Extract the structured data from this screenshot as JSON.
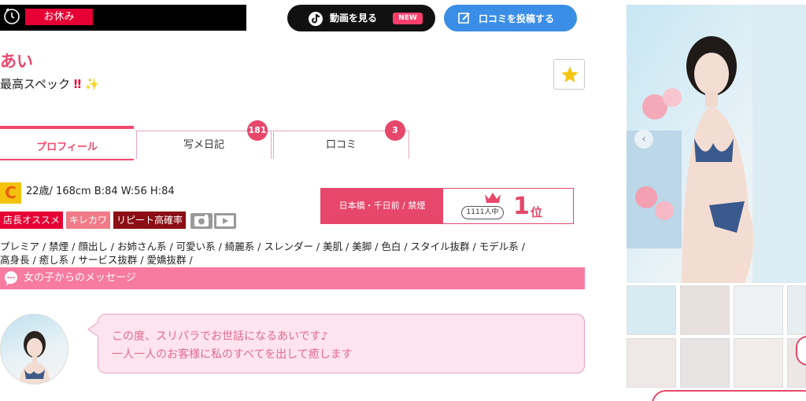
{
  "status": {
    "label": "お休み"
  },
  "buttons": {
    "video_label": "動画を見る",
    "video_badge": "NEW",
    "review_label": "口コミを投稿する"
  },
  "profile": {
    "name": "あい",
    "catchphrase": "最高スペック",
    "catch_bang": "‼",
    "catch_spark": "✨",
    "class_letter": "C",
    "stats": "22歳/ 168cm B:84 W:56 H:84",
    "tags": [
      "店長オススメ",
      "キレカワ",
      "リピート高確率"
    ],
    "types_line1": "プレミア / 禁煙 / 顔出し / お姉さん系 / 可愛い系 / 綺麗系 / スレンダー / 美肌 / 美脚 / 色白 / スタイル抜群 / モデル系 /",
    "types_line2": "高身長 / 癒し系 / サービス抜群 / 愛嬌抜群 /"
  },
  "tabs": [
    {
      "label": "プロフィール"
    },
    {
      "label": "写メ日記",
      "badge": "181"
    },
    {
      "label": "口コミ",
      "badge": "3"
    }
  ],
  "ranking": {
    "area": "日本橋・千日前 / 禁煙",
    "count": "1111人中",
    "rank": "1",
    "unit": "位"
  },
  "message": {
    "header": "女の子からのメッセージ",
    "line1": "この度、スリパラでお世話になるあいです♪",
    "line2": "一人一人のお客様に私のすべてを出して癒します"
  },
  "colors": {
    "accent_pink": "#e6476b",
    "brand_red": "#e60033",
    "review_blue": "#3a8ee6",
    "message_bg": "#fde4ef"
  },
  "icons": [
    "clock-icon",
    "tiktok-icon",
    "edit-icon",
    "star-icon",
    "camera-icon",
    "video-icon",
    "crown-icon",
    "chat-icon",
    "chevron-left-icon"
  ]
}
